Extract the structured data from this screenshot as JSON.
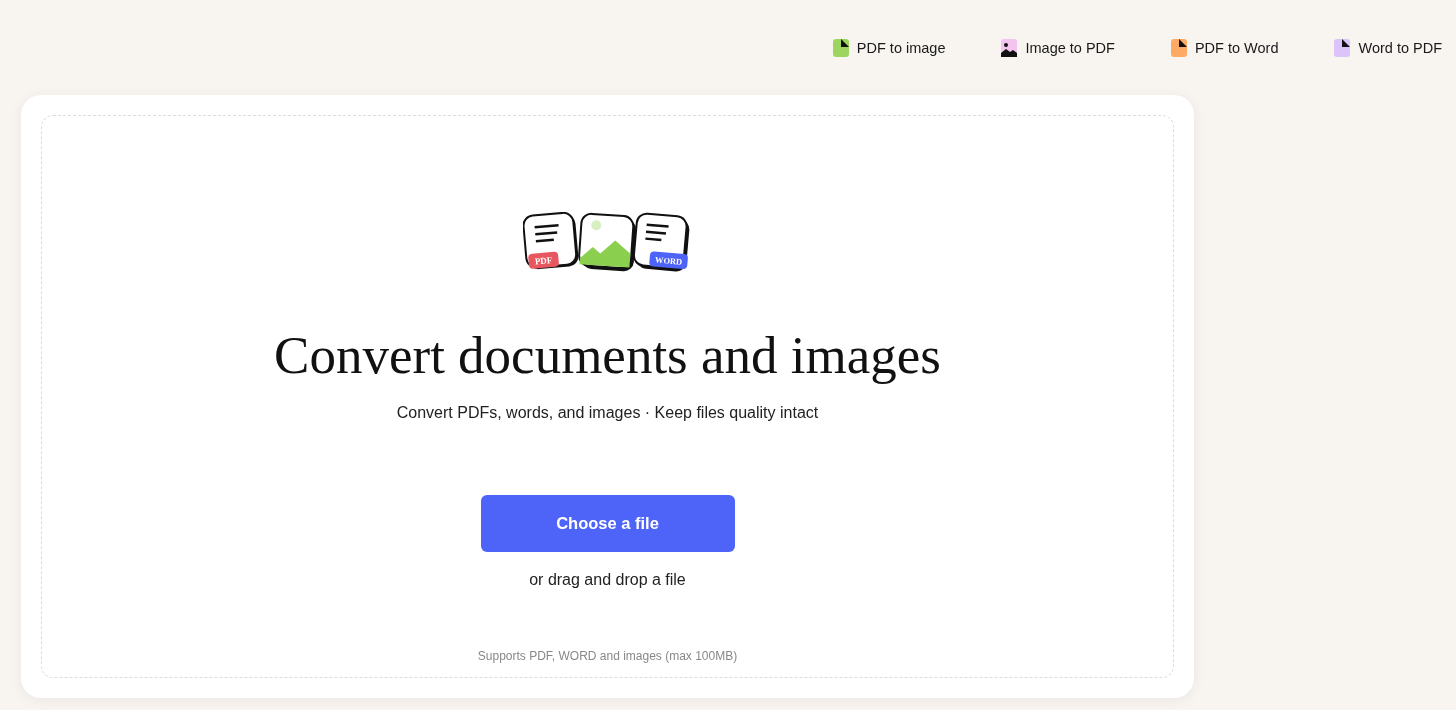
{
  "nav_links": [
    {
      "label": "PDF to image",
      "kind": "document",
      "color": "#9ed55f"
    },
    {
      "label": "Image to PDF",
      "kind": "image",
      "color": "#f2c4ee"
    },
    {
      "label": "PDF to Word",
      "kind": "document",
      "color": "#fdaa65"
    },
    {
      "label": "Word to PDF",
      "kind": "document",
      "color": "#dcc3f9"
    }
  ],
  "upload": {
    "illustration_badges": [
      "PDF",
      "WORD"
    ],
    "title": "Convert documents and images",
    "subtitle": "Convert PDFs, words, and images · Keep files quality intact",
    "button": "Choose a file",
    "drop_hint": "or drag and drop a file",
    "supports_note": "Supports PDF, WORD and images (max 100MB)"
  }
}
